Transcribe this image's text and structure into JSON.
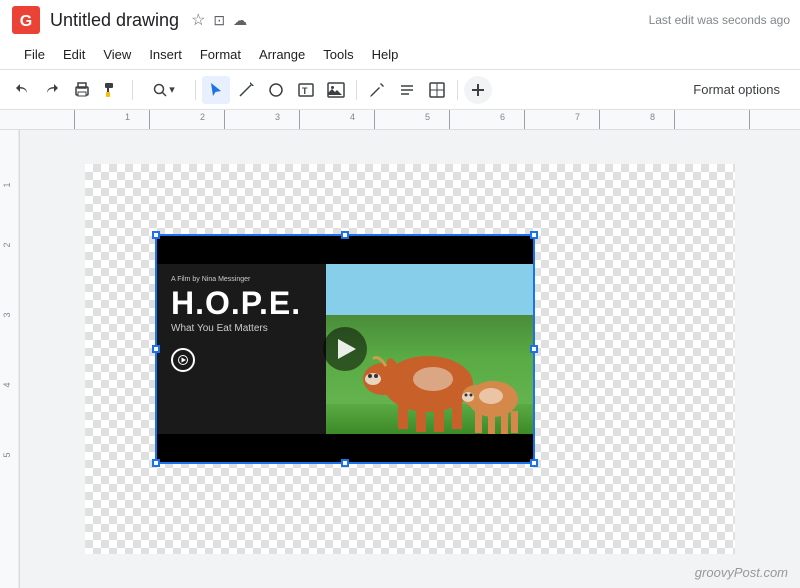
{
  "titleBar": {
    "title": "Untitled drawing",
    "lastEdit": "Last edit was seconds ago",
    "starIcon": "☆",
    "driveIcon": "⊡",
    "cloudIcon": "☁"
  },
  "menuBar": {
    "items": [
      "File",
      "Edit",
      "View",
      "Insert",
      "Format",
      "Arrange",
      "Tools",
      "Help"
    ]
  },
  "toolbar": {
    "formatOptions": "Format options",
    "buttons": [
      {
        "name": "undo",
        "icon": "↩",
        "label": "Undo"
      },
      {
        "name": "redo",
        "icon": "↪",
        "label": "Redo"
      },
      {
        "name": "print",
        "icon": "⎙",
        "label": "Print"
      },
      {
        "name": "paint-format",
        "icon": "🖌",
        "label": "Paint format"
      },
      {
        "name": "zoom",
        "icon": "🔍",
        "label": "Zoom"
      },
      {
        "name": "select",
        "icon": "↖",
        "label": "Select"
      },
      {
        "name": "line",
        "icon": "╲",
        "label": "Line"
      },
      {
        "name": "shape",
        "icon": "○",
        "label": "Shape"
      },
      {
        "name": "text",
        "icon": "T",
        "label": "Text box"
      },
      {
        "name": "image",
        "icon": "⊞",
        "label": "Image"
      },
      {
        "name": "pen",
        "icon": "✏",
        "label": "Pen"
      },
      {
        "name": "wordart",
        "icon": "≡",
        "label": "Word art"
      },
      {
        "name": "table",
        "icon": "⊟",
        "label": "Table"
      },
      {
        "name": "add",
        "icon": "+",
        "label": "Add"
      }
    ]
  },
  "ruler": {
    "numbers": [
      "1",
      "2",
      "3",
      "4",
      "5",
      "6",
      "7",
      "8"
    ]
  },
  "video": {
    "filmCredit": "A Film by Nina Messinger",
    "hopeTitle": "H.O.P.E.",
    "subtitle": "What You Eat Matters"
  },
  "watermark": "groovyPost.com",
  "canvas": {
    "bgColor": "#f1f3f4"
  }
}
